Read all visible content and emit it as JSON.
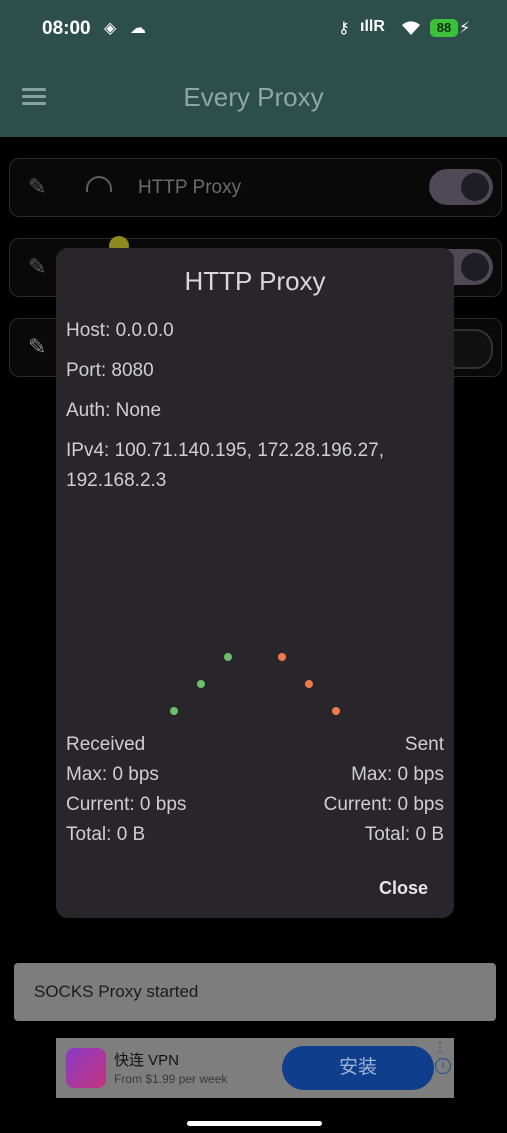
{
  "status_bar": {
    "time": "08:00",
    "battery": "88"
  },
  "app": {
    "title": "Every Proxy"
  },
  "proxies": [
    {
      "name": "HTTP Proxy",
      "enabled": true
    },
    {
      "name": "",
      "enabled": true
    },
    {
      "name": "",
      "enabled": false
    }
  ],
  "dialog": {
    "title": "HTTP Proxy",
    "host": "Host: 0.0.0.0",
    "port": "Port: 8080",
    "auth": "Auth: None",
    "ipv4_line1": "IPv4: 100.71.140.195, 172.28.196.27,",
    "ipv4_line2": "192.168.2.3",
    "received": {
      "label": "Received",
      "max": "Max: 0 bps",
      "current": "Current: 0 bps",
      "total": "Total: 0 B"
    },
    "sent": {
      "label": "Sent",
      "max": "Max: 0 bps",
      "current": "Current: 0 bps",
      "total": "Total: 0 B"
    },
    "close": "Close",
    "colors": {
      "received": "#6dbe6d",
      "sent": "#f07a4a"
    }
  },
  "snackbar": {
    "text": "SOCKS Proxy started"
  },
  "ad": {
    "title": "快连 VPN",
    "subtitle": "From $1.99 per week",
    "button": "安装"
  }
}
